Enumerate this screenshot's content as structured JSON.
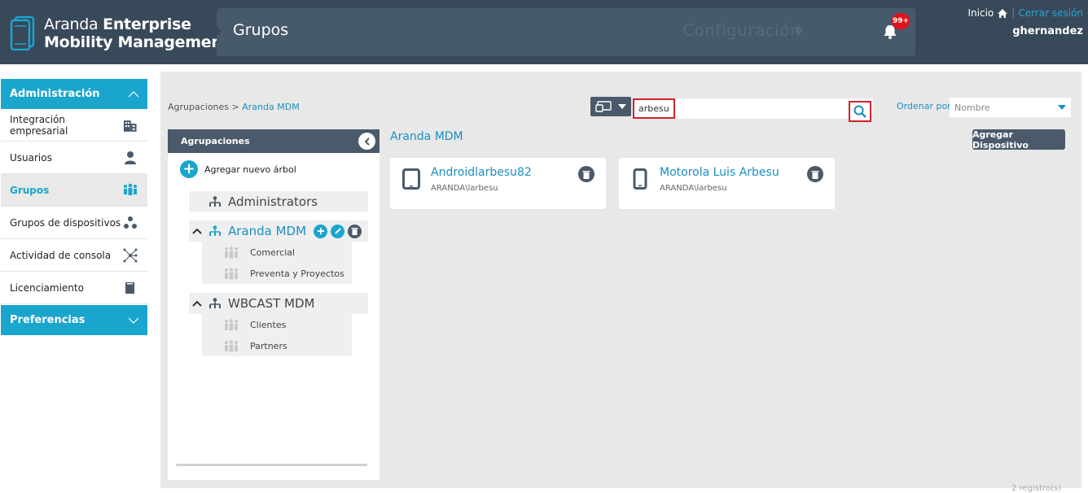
{
  "header": {
    "logo_light": "Aranda",
    "logo_bold1": "Enterprise",
    "logo_bold2": "Mobility Management",
    "page_title": "Grupos",
    "config_label": "Configuración",
    "notification_count": "99+",
    "home_label": "Inicio",
    "separator": "|",
    "logout_label": "Cerrar sesión",
    "username": "ghernandez"
  },
  "sidebar": {
    "admin_section": "Administración",
    "items": [
      {
        "label": "Integración empresarial",
        "icon": "building-icon"
      },
      {
        "label": "Usuarios",
        "icon": "user-icon"
      },
      {
        "label": "Grupos",
        "icon": "group-icon"
      },
      {
        "label": "Grupos de dispositivos",
        "icon": "device-groups-icon"
      },
      {
        "label": "Actividad de consola",
        "icon": "activity-icon"
      },
      {
        "label": "Licenciamiento",
        "icon": "license-icon"
      }
    ],
    "prefs_section": "Preferencias"
  },
  "breadcrumb": {
    "root": "Agrupaciones",
    "separator": " > ",
    "current": "Aranda MDM"
  },
  "search": {
    "value": "arbesu"
  },
  "order": {
    "label": "Ordenar por:",
    "value": "Nombre"
  },
  "tree": {
    "header": "Agrupaciones",
    "add_label": "Agregar nuevo árbol",
    "nodes": [
      {
        "name": "Administrators",
        "children": []
      },
      {
        "name": "Aranda MDM",
        "children": [
          "Comercial",
          "Preventa y Proyectos"
        ]
      },
      {
        "name": "WBCAST MDM",
        "children": [
          "Clientes",
          "Partners"
        ]
      }
    ]
  },
  "main": {
    "title": "Aranda MDM",
    "add_device_label": "Agregar Dispositivo",
    "devices": [
      {
        "name": "Androidlarbesu82",
        "user": "ARANDA\\larbesu",
        "icon": "tablet-icon"
      },
      {
        "name": "Motorola Luis Arbesu",
        "user": "ARANDA\\larbesu",
        "icon": "phone-icon"
      }
    ],
    "records": "2 registro(s)"
  },
  "colors": {
    "header_bg": "#38495a",
    "accent": "#1aa5cd",
    "highlight_border": "#d2232a",
    "badge": "#e0121b"
  }
}
